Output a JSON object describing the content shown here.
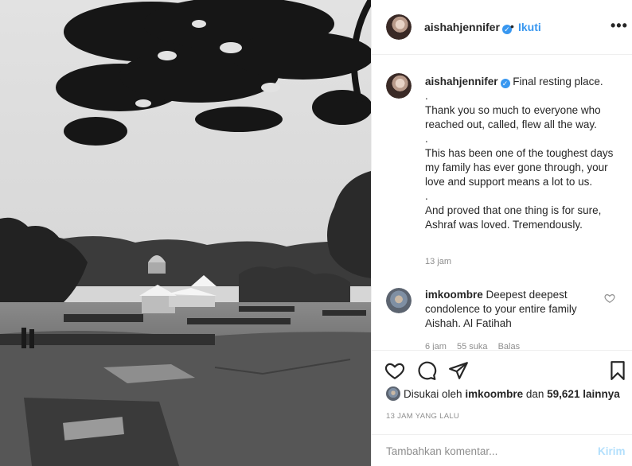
{
  "post": {
    "image_alt": "Black and white photograph of a cemetery with trees and a gazebo",
    "header": {
      "username": "aishahjennifer",
      "dot": "•",
      "follow_label": "Ikuti",
      "more_label": "•••"
    },
    "caption": {
      "username": "aishahjennifer",
      "lines": [
        "Final resting place.",
        ".",
        "Thank you so much to everyone who reached out, called, flew all the way.",
        ".",
        "This has been one of the toughest days my family has ever gone through, your love and support means a lot to us.",
        ".",
        "And proved that one thing is for sure, Ashraf was loved. Tremendously."
      ],
      "time": "13 jam"
    },
    "comments": [
      {
        "username": "imkoombre",
        "text": "Deepest deepest condolence to your entire family Aishah. Al Fatihah",
        "time": "6 jam",
        "likes": "55 suka",
        "reply": "Balas"
      }
    ],
    "likes": {
      "prefix": "Disukai oleh",
      "user": "imkoombre",
      "joiner": "dan",
      "count": "59,621 lainnya"
    },
    "timestamp": "13 JAM YANG LALU",
    "add_comment": {
      "placeholder": "Tambahkan komentar...",
      "post_label": "Kirim"
    }
  },
  "icons": {
    "verified": "verified-badge-icon",
    "like": "heart-icon",
    "comment": "comment-icon",
    "share": "send-icon",
    "save": "bookmark-icon",
    "comment_like": "small-heart-icon"
  },
  "colors": {
    "link_blue": "#3897f0",
    "muted": "#8e8e8e",
    "border": "#efefef",
    "post_disabled": "#b2dffc"
  }
}
